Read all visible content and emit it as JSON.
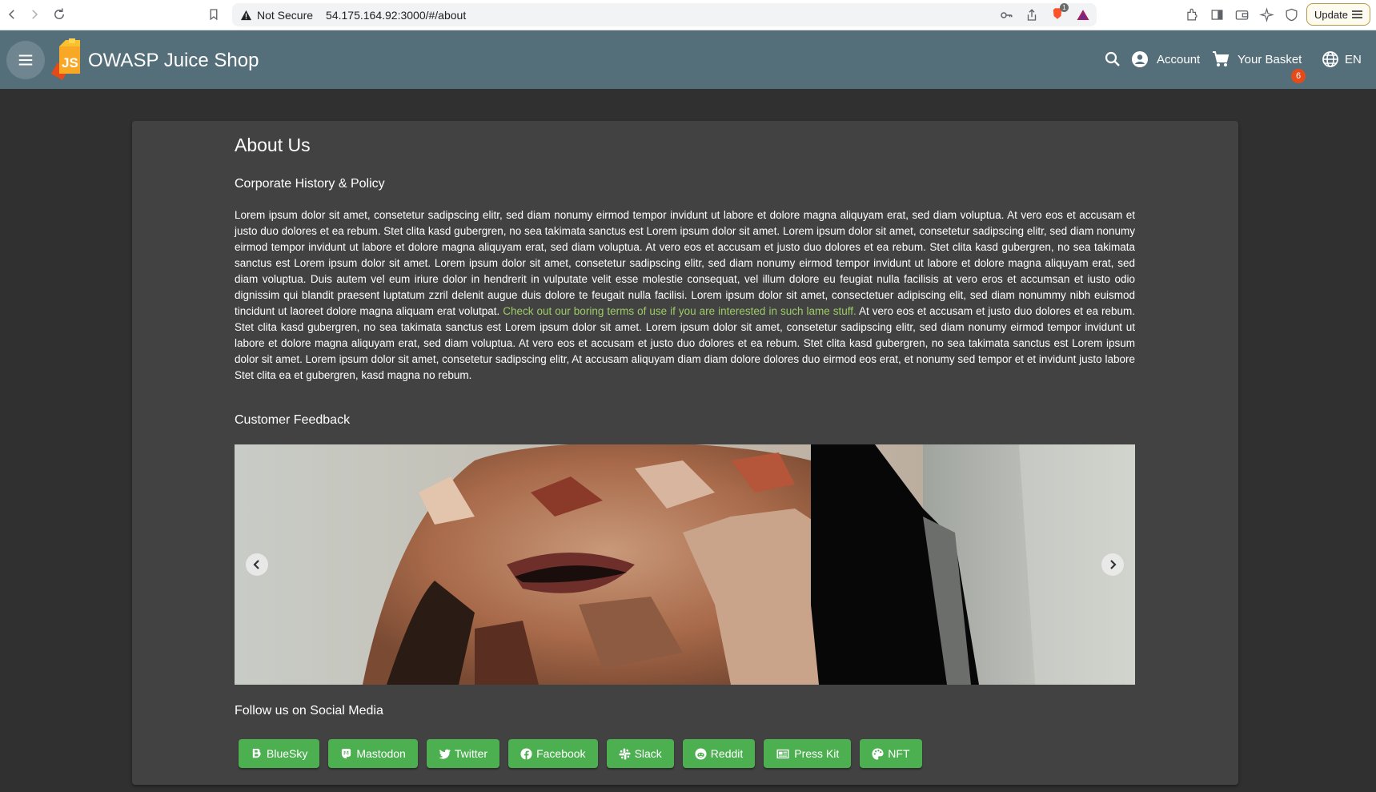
{
  "browser": {
    "security_label": "Not Secure",
    "url": "54.175.164.92:3000/#/about",
    "brave_count": "1",
    "update_label": "Update"
  },
  "toolbar": {
    "title": "OWASP Juice Shop",
    "account_label": "Account",
    "basket_label": "Your Basket",
    "basket_count": "6",
    "language_label": "EN"
  },
  "page": {
    "title": "About Us",
    "corporate_heading": "Corporate History & Policy",
    "paragraph_before_link": "Lorem ipsum dolor sit amet, consetetur sadipscing elitr, sed diam nonumy eirmod tempor invidunt ut labore et dolore magna aliquyam erat, sed diam voluptua. At vero eos et accusam et justo duo dolores et ea rebum. Stet clita kasd gubergren, no sea takimata sanctus est Lorem ipsum dolor sit amet. Lorem ipsum dolor sit amet, consetetur sadipscing elitr, sed diam nonumy eirmod tempor invidunt ut labore et dolore magna aliquyam erat, sed diam voluptua. At vero eos et accusam et justo duo dolores et ea rebum. Stet clita kasd gubergren, no sea takimata sanctus est Lorem ipsum dolor sit amet. Lorem ipsum dolor sit amet, consetetur sadipscing elitr, sed diam nonumy eirmod tempor invidunt ut labore et dolore magna aliquyam erat, sed diam voluptua. Duis autem vel eum iriure dolor in hendrerit in vulputate velit esse molestie consequat, vel illum dolore eu feugiat nulla facilisis at vero eros et accumsan et iusto odio dignissim qui blandit praesent luptatum zzril delenit augue duis dolore te feugait nulla facilisi. Lorem ipsum dolor sit amet, consectetuer adipiscing elit, sed diam nonummy nibh euismod tincidunt ut laoreet dolore magna aliquam erat volutpat.",
    "terms_link": "Check out our boring terms of use if you are interested in such lame stuff.",
    "paragraph_after_link": "At vero eos et accusam et justo duo dolores et ea rebum. Stet clita kasd gubergren, no sea takimata sanctus est Lorem ipsum dolor sit amet. Lorem ipsum dolor sit amet, consetetur sadipscing elitr, sed diam nonumy eirmod tempor invidunt ut labore et dolore magna aliquyam erat, sed diam voluptua. At vero eos et accusam et justo duo dolores et ea rebum. Stet clita kasd gubergren, no sea takimata sanctus est Lorem ipsum dolor sit amet. Lorem ipsum dolor sit amet, consetetur sadipscing elitr, At accusam aliquyam diam diam dolore dolores duo eirmod eos erat, et nonumy sed tempor et et invidunt justo labore Stet clita ea et gubergren, kasd magna no rebum.",
    "feedback_heading": "Customer Feedback",
    "social_heading": "Follow us on Social Media"
  },
  "social_buttons": [
    {
      "label": "BlueSky",
      "icon": "bluesky-icon"
    },
    {
      "label": "Mastodon",
      "icon": "mastodon-icon"
    },
    {
      "label": "Twitter",
      "icon": "twitter-icon"
    },
    {
      "label": "Facebook",
      "icon": "facebook-icon"
    },
    {
      "label": "Slack",
      "icon": "slack-icon"
    },
    {
      "label": "Reddit",
      "icon": "reddit-icon"
    },
    {
      "label": "Press Kit",
      "icon": "newspaper-icon"
    },
    {
      "label": "NFT",
      "icon": "palette-icon"
    }
  ],
  "colors": {
    "toolbar": "#546e7a",
    "background": "#303030",
    "card": "#424242",
    "accent_green": "#4caf50",
    "link_green": "#9ccc65",
    "badge": "#e64a19"
  }
}
